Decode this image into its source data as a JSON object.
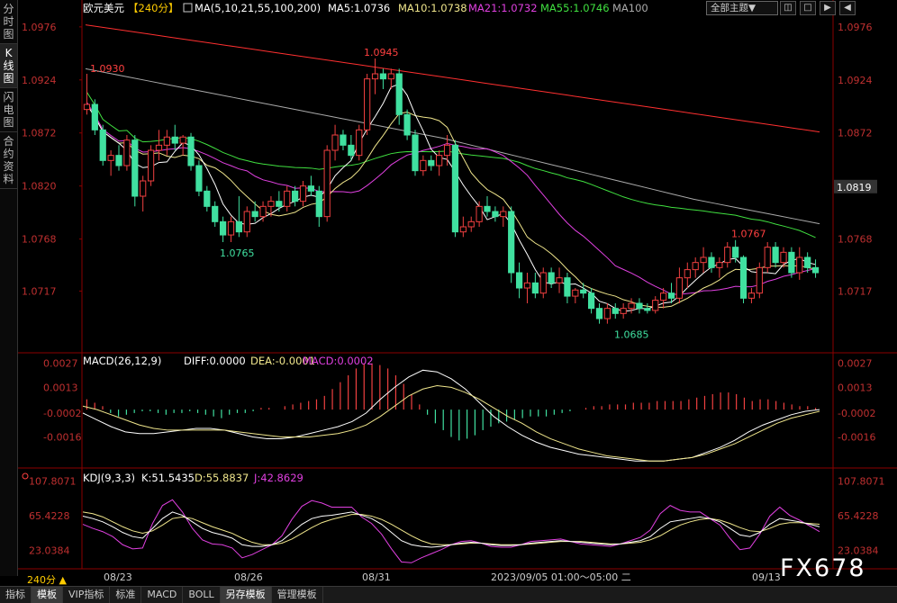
{
  "sidebar": {
    "tabs": [
      {
        "label": "分时图",
        "active": false
      },
      {
        "label": "K线图",
        "active": true
      },
      {
        "label": "闪电图",
        "active": false
      },
      {
        "label": "合约资料",
        "active": false
      }
    ]
  },
  "header": {
    "symbol": "欧元美元",
    "period": "【240分】",
    "ma_title": "MA(5,10,21,55,100,200)",
    "ma_items": [
      {
        "label": "MA5:1.0736",
        "color": "#ffffff"
      },
      {
        "label": "MA10:1.0738",
        "color": "#f0e68c"
      },
      {
        "label": "MA21:1.0732",
        "color": "#e040e0"
      },
      {
        "label": "MA55:1.0746",
        "color": "#40e040"
      },
      {
        "label": "MA100",
        "color": "#aaaaaa"
      }
    ],
    "theme_button": "全部主题▼",
    "window_buttons": [
      "◫",
      "□",
      "▶",
      "◀"
    ]
  },
  "price_axis": {
    "ticks": [
      "1.0976",
      "1.0924",
      "1.0872",
      "1.0820",
      "1.0768",
      "1.0717"
    ],
    "current": "1.0819"
  },
  "annotations": {
    "high1": "1.0930",
    "high2": "1.0945",
    "low1": "1.0765",
    "low2": "1.0685",
    "high3": "1.0767"
  },
  "macd": {
    "title": "MACD(26,12,9)",
    "diff": "DIFF:0.0000",
    "dea": "DEA:-0.0001",
    "macd": "MACD:0.0002",
    "ticks": [
      "0.0027",
      "0.0013",
      "-0.0002",
      "-0.0016"
    ]
  },
  "kdj": {
    "title": "KDJ(9,3,3)",
    "k": "K:51.5435",
    "d": "D:55.8837",
    "j": "J:42.8629",
    "ticks": [
      "107.8071",
      "65.4228",
      "23.0384"
    ]
  },
  "time_axis": {
    "labels": [
      "08/23",
      "08/26",
      "08/31",
      "2023/09/05 01:00～05:00 二",
      "09/13"
    ],
    "period": "240分 ▲"
  },
  "bottom_tabs": [
    "指标",
    "模板",
    "VIP指标",
    "标准",
    "MACD",
    "BOLL",
    "另存模板",
    "管理模板"
  ],
  "watermark": "FX678",
  "colors": {
    "up": "#f04040",
    "down": "#40e0a0",
    "ma5": "#ffffff",
    "ma10": "#f0e68c",
    "ma21": "#e040e0",
    "ma55": "#40e040",
    "ma100": "#aaaaaa",
    "ma200": "#ff3030",
    "axis": "#c03030"
  },
  "chart_data": {
    "type": "candlestick",
    "price_range": [
      1.066,
      1.099
    ],
    "candles": [
      [
        1.0895,
        1.093,
        1.089,
        1.09
      ],
      [
        1.09,
        1.0905,
        1.087,
        1.0875
      ],
      [
        1.0875,
        1.088,
        1.084,
        1.0845
      ],
      [
        1.0845,
        1.0855,
        1.083,
        1.085
      ],
      [
        1.085,
        1.086,
        1.0835,
        1.084
      ],
      [
        1.084,
        1.087,
        1.0835,
        1.0865
      ],
      [
        1.0865,
        1.087,
        1.08,
        1.081
      ],
      [
        1.081,
        1.083,
        1.0795,
        1.0825
      ],
      [
        1.0825,
        1.086,
        1.082,
        1.0855
      ],
      [
        1.0855,
        1.0875,
        1.0845,
        1.086
      ],
      [
        1.086,
        1.0875,
        1.085,
        1.0868
      ],
      [
        1.0868,
        1.088,
        1.0855,
        1.0862
      ],
      [
        1.0862,
        1.087,
        1.085,
        1.0868
      ],
      [
        1.0868,
        1.0872,
        1.0835,
        1.084
      ],
      [
        1.084,
        1.0845,
        1.081,
        1.0815
      ],
      [
        1.0815,
        1.082,
        1.0795,
        1.08
      ],
      [
        1.08,
        1.0805,
        1.078,
        1.0785
      ],
      [
        1.0785,
        1.079,
        1.0765,
        1.0772
      ],
      [
        1.0772,
        1.079,
        1.0765,
        1.0785
      ],
      [
        1.0785,
        1.081,
        1.077,
        1.0775
      ],
      [
        1.0775,
        1.08,
        1.077,
        1.0795
      ],
      [
        1.0795,
        1.0805,
        1.0785,
        1.079
      ],
      [
        1.079,
        1.0805,
        1.0785,
        1.08
      ],
      [
        1.08,
        1.081,
        1.079,
        1.0805
      ],
      [
        1.0805,
        1.0815,
        1.0795,
        1.08
      ],
      [
        1.08,
        1.082,
        1.0795,
        1.0815
      ],
      [
        1.0815,
        1.082,
        1.08,
        1.0805
      ],
      [
        1.0805,
        1.0825,
        1.08,
        1.082
      ],
      [
        1.082,
        1.083,
        1.081,
        1.0815
      ],
      [
        1.0815,
        1.082,
        1.078,
        1.079
      ],
      [
        1.079,
        1.086,
        1.0785,
        1.0855
      ],
      [
        1.0855,
        1.088,
        1.0845,
        1.087
      ],
      [
        1.087,
        1.0875,
        1.0855,
        1.086
      ],
      [
        1.086,
        1.087,
        1.0845,
        1.085
      ],
      [
        1.085,
        1.088,
        1.0845,
        1.0875
      ],
      [
        1.0875,
        1.093,
        1.087,
        1.0925
      ],
      [
        1.0925,
        1.0945,
        1.091,
        1.093
      ],
      [
        1.093,
        1.0935,
        1.0915,
        1.0925
      ],
      [
        1.0925,
        1.0935,
        1.0915,
        1.093
      ],
      [
        1.093,
        1.0935,
        1.088,
        1.089
      ],
      [
        1.089,
        1.0895,
        1.0865,
        1.087
      ],
      [
        1.087,
        1.0875,
        1.083,
        1.0835
      ],
      [
        1.0835,
        1.085,
        1.083,
        1.0845
      ],
      [
        1.0845,
        1.085,
        1.0835,
        1.084
      ],
      [
        1.084,
        1.0855,
        1.083,
        1.085
      ],
      [
        1.085,
        1.087,
        1.084,
        1.086
      ],
      [
        1.086,
        1.0865,
        1.077,
        1.0775
      ],
      [
        1.0775,
        1.079,
        1.077,
        1.078
      ],
      [
        1.078,
        1.079,
        1.0775,
        1.0785
      ],
      [
        1.0785,
        1.0805,
        1.078,
        1.08
      ],
      [
        1.08,
        1.081,
        1.079,
        1.0795
      ],
      [
        1.0795,
        1.08,
        1.0785,
        1.079
      ],
      [
        1.079,
        1.08,
        1.078,
        1.0795
      ],
      [
        1.0795,
        1.08,
        1.0725,
        1.0735
      ],
      [
        1.0735,
        1.0745,
        1.071,
        1.072
      ],
      [
        1.072,
        1.0735,
        1.0705,
        1.0725
      ],
      [
        1.0725,
        1.0735,
        1.071,
        1.0715
      ],
      [
        1.0715,
        1.074,
        1.071,
        1.0735
      ],
      [
        1.0735,
        1.074,
        1.072,
        1.0725
      ],
      [
        1.0725,
        1.074,
        1.0715,
        1.073
      ],
      [
        1.073,
        1.0735,
        1.0705,
        1.0712
      ],
      [
        1.0712,
        1.072,
        1.0705,
        1.0718
      ],
      [
        1.0718,
        1.0725,
        1.071,
        1.0715
      ],
      [
        1.0715,
        1.072,
        1.0695,
        1.07
      ],
      [
        1.07,
        1.0705,
        1.0685,
        1.069
      ],
      [
        1.069,
        1.0705,
        1.0685,
        1.07
      ],
      [
        1.07,
        1.0705,
        1.069,
        1.0695
      ],
      [
        1.0695,
        1.0705,
        1.069,
        1.07
      ],
      [
        1.07,
        1.071,
        1.0695,
        1.0705
      ],
      [
        1.0705,
        1.071,
        1.0695,
        1.07
      ],
      [
        1.07,
        1.0705,
        1.0695,
        1.0698
      ],
      [
        1.0698,
        1.0712,
        1.0695,
        1.0708
      ],
      [
        1.0708,
        1.072,
        1.07,
        1.0715
      ],
      [
        1.0715,
        1.0725,
        1.0705,
        1.071
      ],
      [
        1.071,
        1.074,
        1.0705,
        1.073
      ],
      [
        1.073,
        1.0745,
        1.072,
        1.0738
      ],
      [
        1.0738,
        1.075,
        1.073,
        1.0745
      ],
      [
        1.0745,
        1.076,
        1.0735,
        1.075
      ],
      [
        1.075,
        1.0755,
        1.0735,
        1.074
      ],
      [
        1.074,
        1.075,
        1.073,
        1.0745
      ],
      [
        1.0745,
        1.0765,
        1.074,
        1.076
      ],
      [
        1.076,
        1.0767,
        1.0745,
        1.075
      ],
      [
        1.075,
        1.0752,
        1.0705,
        1.071
      ],
      [
        1.071,
        1.072,
        1.0705,
        1.0715
      ],
      [
        1.0715,
        1.0745,
        1.071,
        1.074
      ],
      [
        1.074,
        1.0765,
        1.0735,
        1.076
      ],
      [
        1.076,
        1.0765,
        1.074,
        1.0745
      ],
      [
        1.0745,
        1.076,
        1.074,
        1.0755
      ],
      [
        1.0755,
        1.076,
        1.073,
        1.0735
      ],
      [
        1.0735,
        1.076,
        1.0728,
        1.075
      ],
      [
        1.075,
        1.0755,
        1.0735,
        1.074
      ],
      [
        1.074,
        1.0748,
        1.073,
        1.0735
      ]
    ],
    "ma200": [
      1.0978,
      1.0975,
      1.0972,
      1.0969,
      1.0966,
      1.0963,
      1.096,
      1.0957,
      1.0954,
      1.0951,
      1.0948,
      1.0945,
      1.0942,
      1.0939,
      1.0936,
      1.0933,
      1.093,
      1.0927,
      1.0924,
      1.0921,
      1.0918,
      1.0915,
      1.0912,
      1.0909,
      1.0906,
      1.0903,
      1.09,
      1.0897,
      1.0894,
      1.0891,
      1.0888,
      1.0885,
      1.0882,
      1.0879,
      1.0876,
      1.0873
    ],
    "ma100": [
      1.0935,
      1.0931,
      1.0927,
      1.0923,
      1.0919,
      1.0915,
      1.0911,
      1.0907,
      1.0903,
      1.0899,
      1.0895,
      1.0891,
      1.0887,
      1.0883,
      1.0879,
      1.0875,
      1.0871,
      1.0867,
      1.0862,
      1.0857,
      1.0852,
      1.0847,
      1.0842,
      1.0837,
      1.0832,
      1.0827,
      1.0822,
      1.0817,
      1.0812,
      1.0807,
      1.0803,
      1.0799,
      1.0795,
      1.0791,
      1.0787,
      1.0783
    ],
    "macd_hist": [
      0.0006,
      0.0004,
      0.0002,
      -0.0002,
      -0.0004,
      -0.0003,
      -0.0002,
      -0.0001,
      -0.0001,
      -0.0002,
      -0.0003,
      -0.0002,
      -0.0002,
      -0.0001,
      -0.0002,
      -0.0003,
      -0.0004,
      -0.0005,
      -0.0003,
      -0.0002,
      -0.0002,
      -0.0001,
      0.0001,
      0.0001,
      0.0,
      0.0002,
      0.0003,
      0.0004,
      0.0005,
      0.0006,
      0.0008,
      0.0012,
      0.0016,
      0.002,
      0.0024,
      0.0027,
      0.0027,
      0.0026,
      0.0024,
      0.002,
      0.0015,
      0.0009,
      0.0003,
      -0.0003,
      -0.0008,
      -0.0012,
      -0.0016,
      -0.0018,
      -0.0017,
      -0.0015,
      -0.0012,
      -0.001,
      -0.0008,
      -0.0007,
      -0.0006,
      -0.0005,
      -0.0004,
      -0.0004,
      -0.0004,
      -0.0003,
      -0.0002,
      -0.0001,
      0.0,
      0.0001,
      0.0002,
      0.0002,
      0.0003,
      0.0003,
      0.0003,
      0.0004,
      0.0004,
      0.0004,
      0.0005,
      0.0005,
      0.0005,
      0.0005,
      0.0006,
      0.0007,
      0.0008,
      0.0009,
      0.001,
      0.001,
      0.0009,
      0.0007,
      0.0005,
      0.0006,
      0.0006,
      0.0005,
      0.0004,
      0.0003,
      0.0002,
      0.0002,
      0.0001
    ],
    "macd_diff": [
      -0.0002,
      -0.0006,
      -0.001,
      -0.0013,
      -0.0014,
      -0.0014,
      -0.0013,
      -0.0012,
      -0.0011,
      -0.0011,
      -0.0012,
      -0.0014,
      -0.0016,
      -0.0017,
      -0.0017,
      -0.0016,
      -0.0014,
      -0.0012,
      -0.001,
      -0.0007,
      -0.0002,
      0.0006,
      0.0013,
      0.0019,
      0.0023,
      0.0022,
      0.0018,
      0.0012,
      0.0004,
      -0.0004,
      -0.001,
      -0.0015,
      -0.0019,
      -0.0022,
      -0.0024,
      -0.0026,
      -0.0027,
      -0.0028,
      -0.0029,
      -0.003,
      -0.003,
      -0.003,
      -0.0029,
      -0.0028,
      -0.0025,
      -0.0022,
      -0.0018,
      -0.0013,
      -0.0009,
      -0.0006,
      -0.0003,
      -0.0001,
      0.0
    ],
    "macd_dea": [
      0.0002,
      0.0,
      -0.0003,
      -0.0006,
      -0.0009,
      -0.0011,
      -0.0012,
      -0.0012,
      -0.0012,
      -0.0012,
      -0.0012,
      -0.0013,
      -0.0014,
      -0.0015,
      -0.0016,
      -0.0016,
      -0.0016,
      -0.0015,
      -0.0014,
      -0.0012,
      -0.0009,
      -0.0004,
      0.0002,
      0.0008,
      0.0012,
      0.0014,
      0.0013,
      0.001,
      0.0006,
      0.0001,
      -0.0004,
      -0.0008,
      -0.0013,
      -0.0017,
      -0.002,
      -0.0023,
      -0.0025,
      -0.0027,
      -0.0028,
      -0.0029,
      -0.003,
      -0.003,
      -0.0029,
      -0.0028,
      -0.0026,
      -0.0023,
      -0.002,
      -0.0016,
      -0.0012,
      -0.0008,
      -0.0005,
      -0.0003,
      -0.0001
    ],
    "kdj_k": [
      65,
      62,
      58,
      52,
      45,
      40,
      38,
      50,
      62,
      70,
      66,
      58,
      50,
      45,
      42,
      38,
      30,
      28,
      28,
      30,
      35,
      45,
      55,
      62,
      65,
      66,
      68,
      70,
      66,
      62,
      55,
      45,
      35,
      30,
      28,
      27,
      28,
      30,
      32,
      33,
      32,
      30,
      29,
      29,
      30,
      32,
      33,
      34,
      35,
      34,
      33,
      32,
      31,
      30,
      31,
      33,
      35,
      40,
      50,
      58,
      60,
      62,
      64,
      62,
      58,
      50,
      42,
      40,
      45,
      55,
      62,
      60,
      58,
      55,
      52
    ],
    "kdj_d": [
      70,
      68,
      64,
      58,
      52,
      47,
      44,
      47,
      54,
      62,
      64,
      62,
      57,
      52,
      48,
      44,
      38,
      33,
      30,
      30,
      32,
      37,
      44,
      51,
      57,
      61,
      64,
      67,
      67,
      65,
      61,
      55,
      48,
      41,
      35,
      31,
      30,
      30,
      31,
      32,
      32,
      31,
      30,
      30,
      30,
      31,
      32,
      33,
      34,
      34,
      34,
      33,
      32,
      31,
      31,
      32,
      33,
      36,
      41,
      48,
      54,
      58,
      61,
      62,
      60,
      56,
      51,
      47,
      46,
      50,
      55,
      57,
      57,
      56,
      55
    ],
    "kdj_j": [
      55,
      50,
      46,
      40,
      30,
      25,
      26,
      56,
      78,
      85,
      70,
      50,
      36,
      31,
      30,
      26,
      14,
      18,
      24,
      30,
      41,
      61,
      77,
      84,
      81,
      76,
      76,
      76,
      64,
      56,
      43,
      25,
      9,
      8,
      14,
      19,
      24,
      30,
      34,
      35,
      32,
      28,
      27,
      27,
      30,
      34,
      35,
      36,
      37,
      34,
      31,
      30,
      29,
      28,
      31,
      35,
      39,
      48,
      68,
      78,
      72,
      70,
      70,
      62,
      54,
      38,
      24,
      26,
      43,
      65,
      76,
      66,
      60,
      53,
      46
    ]
  }
}
